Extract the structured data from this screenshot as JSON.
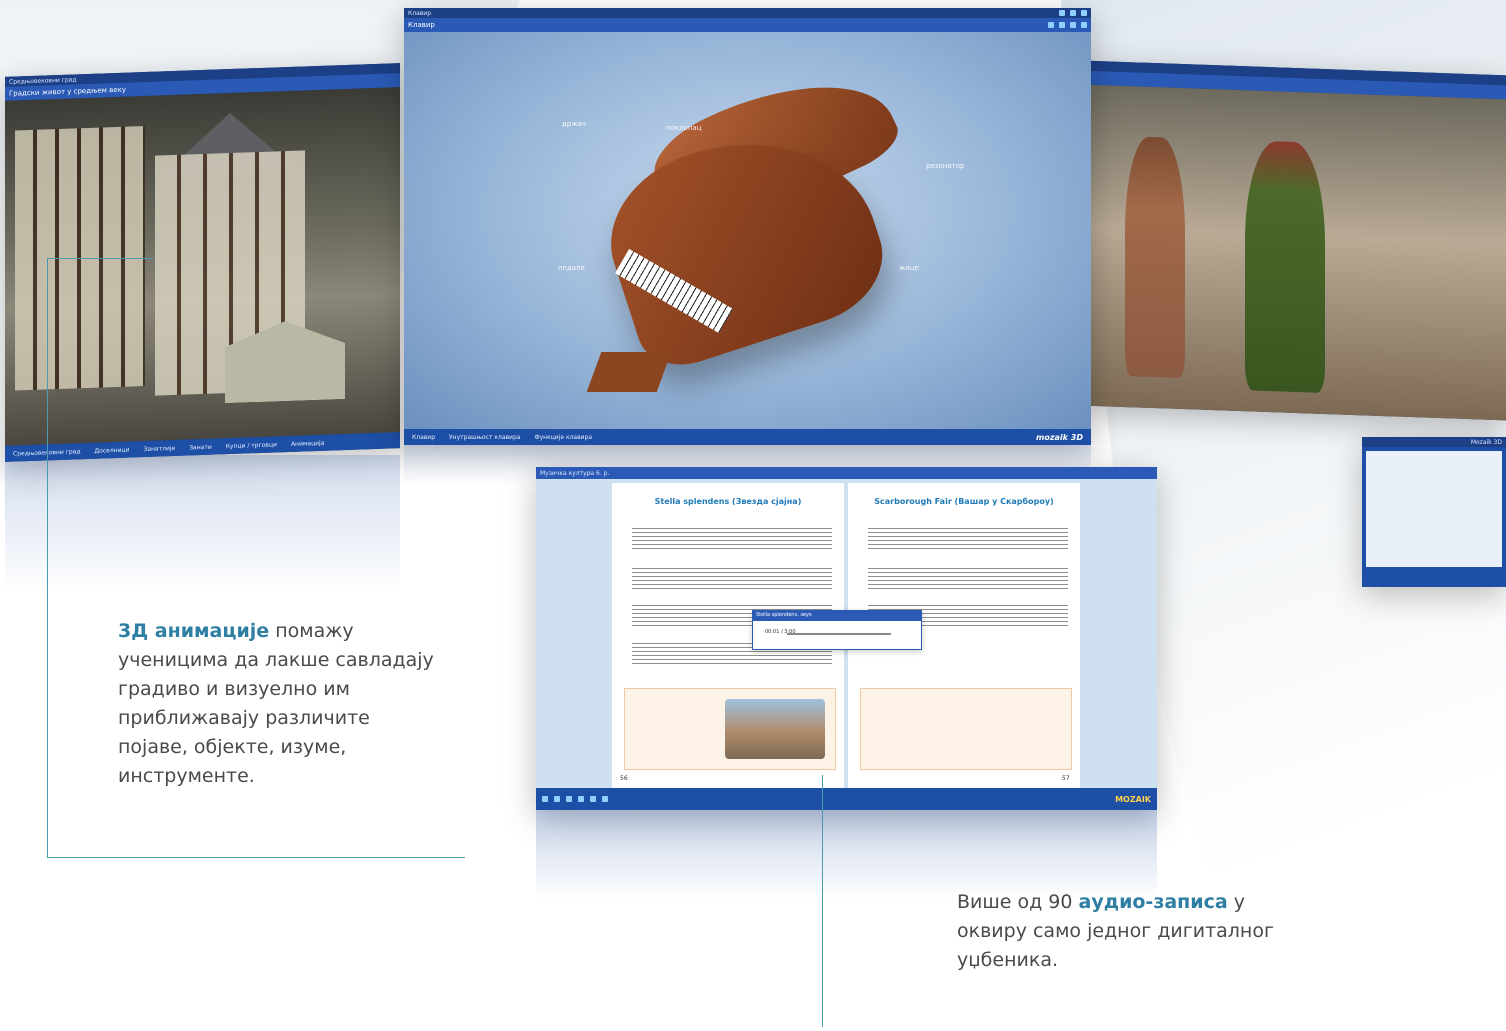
{
  "left_window": {
    "tab": "Средњовековни град",
    "subtitle": "Градски живот у средњем веку",
    "bottom_items": [
      "Средњовековни град",
      "Доселници",
      "Занатлије",
      "Занати",
      "Купци / трговци",
      "Анимација"
    ]
  },
  "piano_window": {
    "tab": "Клавир",
    "subtitle": "Клавир",
    "labels": [
      "држач",
      "поклопац",
      "резонатор",
      "педале",
      "жице"
    ],
    "bottom_items": [
      "Клавир",
      "Унутрашњост клавира",
      "Функције клавира"
    ],
    "brand": "mozaik 3D"
  },
  "right_window": {
    "brand": "Mozaik 3D"
  },
  "book_window": {
    "tab": "Музичка култура 6. р.",
    "left_song": "Stella splendens (Звезда сјајна)",
    "right_song": "Scarborough Fair (Вашар у Скарбороу)",
    "player_title": "Stella splendens, звук",
    "player_time": "00:01 / 3:00",
    "left_page": "56",
    "right_page": "57",
    "toolbar_brand": "MOZAIK"
  },
  "caption_left": {
    "highlight": "3Д анимације",
    "text": " помажу ученицима да лакше савладају градиво и визуелно им приближавају различите појаве, објекте, изуме, инструменте."
  },
  "caption_right": {
    "prefix": "Више од 90 ",
    "highlight": "аудио-записа",
    "text": " у оквиру само једног дигиталног уџбеника."
  },
  "colors": {
    "accent": "#2e7fa3",
    "window": "#1e4fa6",
    "line": "#4a9bb0"
  }
}
